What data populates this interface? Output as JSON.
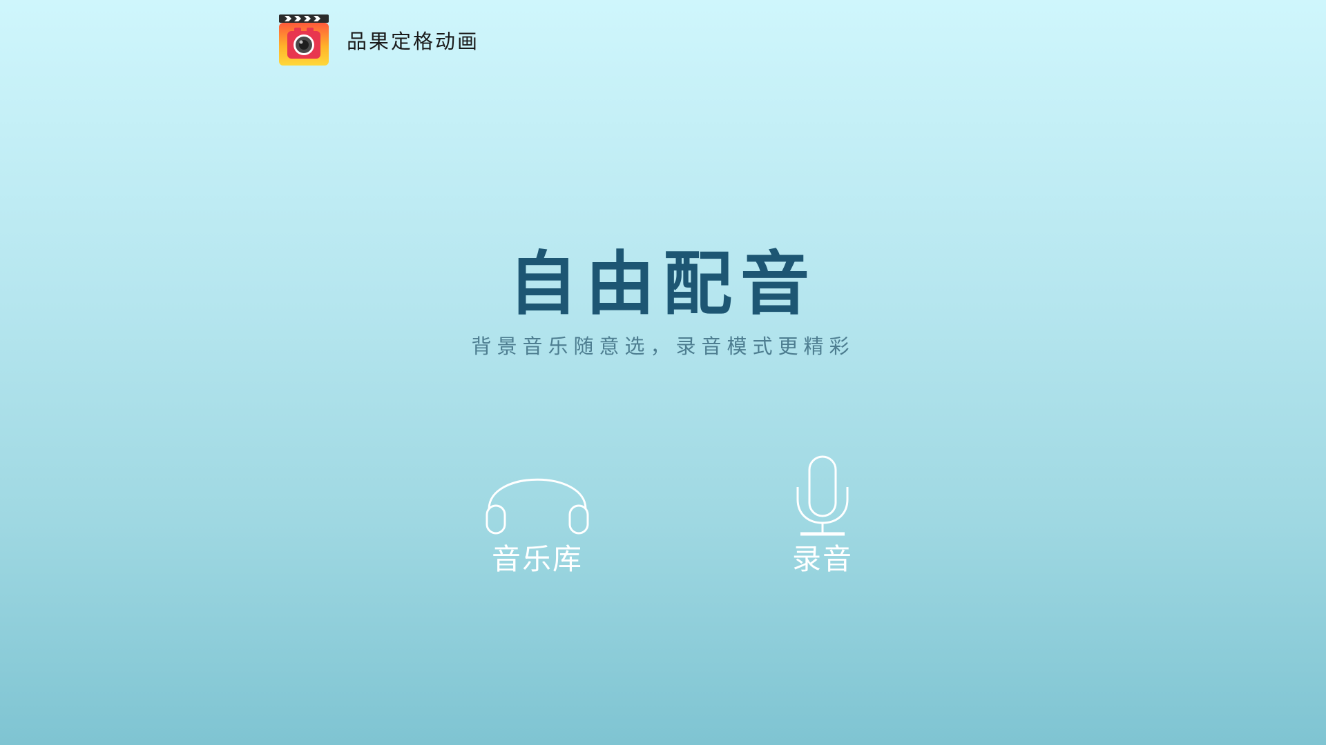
{
  "app": {
    "title": "品果定格动画",
    "icon": "clapperboard-camera-icon"
  },
  "hero": {
    "title": "自由配音",
    "subtitle": "背景音乐随意选，录音模式更精彩"
  },
  "features": [
    {
      "label": "音乐库",
      "icon": "headphones-icon"
    },
    {
      "label": "录音",
      "icon": "microphone-icon"
    }
  ],
  "colors": {
    "background_top": "#cff6fc",
    "background_bottom": "#7fc4d2",
    "title": "#1d5673",
    "subtitle": "#4d7d90",
    "feature": "#ffffff"
  }
}
